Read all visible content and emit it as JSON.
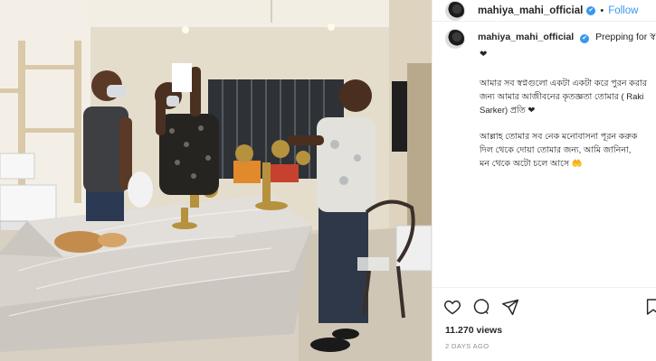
{
  "post": {
    "username": "mahiya_mahi_official",
    "verified_mark": "✔",
    "separator": "•",
    "follow_label": "Follow"
  },
  "caption": {
    "username": "mahiya_mahi_official",
    "first_line": "Prepping for স্ব",
    "heart": "❤",
    "paragraph1": [
      "আমার সব স্বপ্নগুলো একটা একটা করে পুরন করার",
      "জন্য আমার আজীবনের কৃতজ্ঞতা তোমার ( Raki",
      "Sarker) প্রতি ❤"
    ],
    "paragraph2": [
      "আল্লাহ তোমার সব নেক মনোবাসনা পূরন করুক",
      " দিল থেকে দোয়া তোমার জন্য, আমি জানিনা,",
      "মন থেকে অটো চলে আসে 🤲"
    ]
  },
  "actions": {
    "like_icon": "heart-outline-icon",
    "comment_icon": "comment-icon",
    "share_icon": "paper-plane-icon",
    "save_icon": "bookmark-icon"
  },
  "stats": {
    "views": "11.270 views",
    "timestamp": "2 DAYS AGO"
  }
}
